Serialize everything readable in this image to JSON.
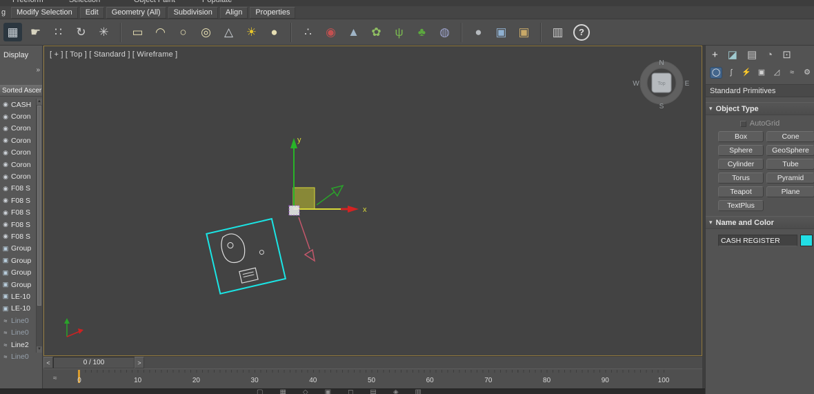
{
  "ribbon": {
    "top_tabs": [
      "Freeform",
      "Selection",
      "Object Paint",
      "Populate"
    ],
    "edge_label": "g",
    "tabs": [
      "Modify Selection",
      "Edit",
      "Geometry (All)",
      "Subdivision",
      "Align",
      "Properties"
    ]
  },
  "toolbar": {
    "groups": [
      [
        {
          "name": "scene-grid-icon",
          "glyph": "▦",
          "color": "#ccd2d8",
          "bg": "#2c3740"
        },
        {
          "name": "paint-select-icon",
          "glyph": "☛",
          "color": "#d8d4c0"
        },
        {
          "name": "paint-dots-icon",
          "glyph": "∷",
          "color": "#d0d0d0"
        },
        {
          "name": "rotate-brush-icon",
          "glyph": "↻",
          "color": "#cfcfcf"
        },
        {
          "name": "spray-brush-icon",
          "glyph": "✳",
          "color": "#cfcfcf"
        }
      ],
      [
        {
          "name": "rectangle-primitive-icon",
          "glyph": "▭",
          "color": "#e6deb2"
        },
        {
          "name": "dome-primitive-icon",
          "glyph": "◠",
          "color": "#e6deb2"
        },
        {
          "name": "ring-primitive-icon",
          "glyph": "○",
          "color": "#e6deb2"
        },
        {
          "name": "torus-primitive-icon",
          "glyph": "◎",
          "color": "#e6deb2"
        },
        {
          "name": "cone-primitive-icon",
          "glyph": "△",
          "color": "#cfd4da"
        },
        {
          "name": "sun-icon",
          "glyph": "☀",
          "color": "#e8c62c"
        },
        {
          "name": "sphere-primitive-icon",
          "glyph": "●",
          "color": "#e6deb2"
        }
      ],
      [
        {
          "name": "scatter-icon",
          "glyph": "∴",
          "color": "#cfcfcf"
        },
        {
          "name": "spheres-pair-icon",
          "glyph": "◉",
          "color": "#c25050"
        },
        {
          "name": "wire-pyramid-icon",
          "glyph": "▲",
          "color": "#9fb4c6"
        },
        {
          "name": "flower-icon",
          "glyph": "✿",
          "color": "#8fbe62"
        },
        {
          "name": "grass-icon",
          "glyph": "ψ",
          "color": "#79b650"
        },
        {
          "name": "tree-icon",
          "glyph": "♣",
          "color": "#5ca83e"
        },
        {
          "name": "swirl-icon",
          "glyph": "◍",
          "color": "#9aa0c8"
        }
      ],
      [
        {
          "name": "gray-sphere-icon",
          "glyph": "●",
          "color": "#b6babe"
        },
        {
          "name": "render-frame-icon",
          "glyph": "▣",
          "color": "#8fb0d0"
        },
        {
          "name": "render-frame-alt-icon",
          "glyph": "▣",
          "color": "#c8a968"
        }
      ],
      [
        {
          "name": "architecture-columns-icon",
          "glyph": "▥",
          "color": "#c8c8c8"
        },
        {
          "name": "help-icon",
          "glyph": "?",
          "color": "#e0e0e0"
        }
      ]
    ]
  },
  "ui": {
    "rollout_arrow": "▾",
    "scroll_up": "▲",
    "scroll_down": "▼",
    "overflow": "»"
  },
  "explorer": {
    "title": "Display",
    "column_header": "Sorted Ascer",
    "icon_glyphs": {
      "geom": "◉",
      "group": "▣",
      "line": "≈"
    },
    "icon_colors": {
      "geom": "#ccd1d7",
      "group": "#b9cedd",
      "line": "#c6ccd2"
    },
    "items": [
      {
        "label": "CASH",
        "type": "geom",
        "muted": false
      },
      {
        "label": "Coron",
        "type": "geom",
        "muted": false
      },
      {
        "label": "Coron",
        "type": "geom",
        "muted": false
      },
      {
        "label": "Coron",
        "type": "geom",
        "muted": false
      },
      {
        "label": "Coron",
        "type": "geom",
        "muted": false
      },
      {
        "label": "Coron",
        "type": "geom",
        "muted": false
      },
      {
        "label": "Coron",
        "type": "geom",
        "muted": false
      },
      {
        "label": "F08 S",
        "type": "geom",
        "muted": false
      },
      {
        "label": "F08 S",
        "type": "geom",
        "muted": false
      },
      {
        "label": "F08 S",
        "type": "geom",
        "muted": false
      },
      {
        "label": "F08 S",
        "type": "geom",
        "muted": false
      },
      {
        "label": "F08 S",
        "type": "geom",
        "muted": false
      },
      {
        "label": "Group",
        "type": "group",
        "muted": false
      },
      {
        "label": "Group",
        "type": "group",
        "muted": false
      },
      {
        "label": "Group",
        "type": "group",
        "muted": false
      },
      {
        "label": "Group",
        "type": "group",
        "muted": false
      },
      {
        "label": "LE-10",
        "type": "group",
        "muted": false
      },
      {
        "label": "LE-10",
        "type": "group",
        "muted": false
      },
      {
        "label": "Line0",
        "type": "line",
        "muted": true
      },
      {
        "label": "Line0",
        "type": "line",
        "muted": true
      },
      {
        "label": "Line2",
        "type": "line",
        "muted": false
      },
      {
        "label": "Line0",
        "type": "line",
        "muted": true
      }
    ]
  },
  "viewport": {
    "label": "[ + ] [ Top ] [ Standard ] [ Wireframe ]",
    "axes": {
      "x": "x",
      "y": "y"
    },
    "compass": {
      "n": "N",
      "e": "E",
      "s": "S",
      "w": "W",
      "center": "Top"
    }
  },
  "timeline": {
    "prev": "<",
    "next": ">",
    "value": "0 / 100",
    "trackbar_icon": "≈",
    "ticks": [
      "0",
      "10",
      "20",
      "30",
      "40",
      "50",
      "60",
      "70",
      "80",
      "90",
      "100"
    ]
  },
  "statusbar": {
    "icons": [
      {
        "name": "status-icon-1",
        "glyph": "▢"
      },
      {
        "name": "status-icon-2",
        "glyph": "▦"
      },
      {
        "name": "status-icon-3",
        "glyph": "◇"
      },
      {
        "name": "status-icon-4",
        "glyph": "▣"
      },
      {
        "name": "status-icon-5",
        "glyph": "◻"
      },
      {
        "name": "status-icon-6",
        "glyph": "▤"
      },
      {
        "name": "status-icon-7",
        "glyph": "◈"
      },
      {
        "name": "status-icon-8",
        "glyph": "▥"
      }
    ]
  },
  "command_panel": {
    "tabs_row1": [
      {
        "name": "create-tab",
        "glyph": "+",
        "color": "#ececec",
        "active": false
      },
      {
        "name": "modify-tab",
        "glyph": "◪",
        "color": "#9fc9cf",
        "active": false
      },
      {
        "name": "hierarchy-tab",
        "glyph": "▤",
        "color": "#c9c9c9",
        "active": false
      },
      {
        "name": "motion-tab",
        "glyph": "◔",
        "color": "#b9b9b9",
        "active": false
      },
      {
        "name": "display-tab",
        "glyph": "⊡",
        "color": "#c9c9c9",
        "active": false
      }
    ],
    "tabs_row2": [
      {
        "name": "geometry-category",
        "glyph": "◯",
        "color": "#f2f2f2",
        "active": true
      },
      {
        "name": "shapes-category",
        "glyph": "ʃ",
        "color": "#d2d2d2",
        "active": false
      },
      {
        "name": "lights-category",
        "glyph": "⚡",
        "color": "#d2d2d2",
        "active": false
      },
      {
        "name": "cameras-category",
        "glyph": "▣",
        "color": "#d2d2d2",
        "active": false
      },
      {
        "name": "helpers-category",
        "glyph": "◿",
        "color": "#d2d2d2",
        "active": false
      },
      {
        "name": "spacewarps-category",
        "glyph": "≈",
        "color": "#d2d2d2",
        "active": false
      },
      {
        "name": "systems-category",
        "glyph": "⚙",
        "color": "#d2d2d2",
        "active": false
      }
    ],
    "category_label": "Standard Primitives",
    "object_type": {
      "title": "Object Type",
      "autogrid_label": "AutoGrid",
      "buttons": [
        "Box",
        "Cone",
        "Sphere",
        "GeoSphere",
        "Cylinder",
        "Tube",
        "Torus",
        "Pyramid",
        "Teapot",
        "Plane",
        "TextPlus"
      ]
    },
    "name_color": {
      "title": "Name and Color",
      "object_name": "CASH REGISTER",
      "swatch_color": "#22dfe6"
    }
  }
}
